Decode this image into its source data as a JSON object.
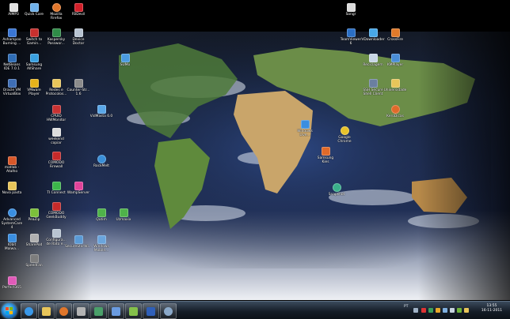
{
  "desktop": {
    "icons": [
      {
        "label": "AIMP3",
        "icon": "aimp-icon",
        "color": "#e2e2e2"
      },
      {
        "label": "Quick Care",
        "icon": "quickcare-icon",
        "color": "#6fb1ea"
      },
      {
        "label": "Mozilla Firefox",
        "icon": "firefox-icon",
        "color": "#e0762b"
      },
      {
        "label": "FBDevil",
        "icon": "fbdevil-icon",
        "color": "#d2202a"
      },
      {
        "label": "Ashampoo Burning ...",
        "icon": "ashampoo-icon",
        "color": "#3a76d4"
      },
      {
        "label": "Switch to Gamin...",
        "icon": "switch-gaming-icon",
        "color": "#c8302e"
      },
      {
        "label": "Kaspersky Passwor...",
        "icon": "kaspersky-icon",
        "color": "#2f8c47"
      },
      {
        "label": "Device Doctor",
        "icon": "device-doctor-icon",
        "color": "#b8c4d2"
      },
      {
        "label": "NetBeans IDE 7.0.1",
        "icon": "netbeans-icon",
        "color": "#2f6db5"
      },
      {
        "label": "Samsung AllShare",
        "icon": "allshare-icon",
        "color": "#3aa0e0"
      },
      {
        "label": "Oracle VM VirtualBox",
        "icon": "virtualbox-icon",
        "color": "#3f6fb6"
      },
      {
        "label": "VMware Player",
        "icon": "vmware-icon",
        "color": "#e6b21a"
      },
      {
        "label": "Redes e Protocolos...",
        "icon": "folder-icon",
        "color": "#e8c55a"
      },
      {
        "label": "Counter-Str... 1.6",
        "icon": "counter-strike-icon",
        "color": "#8c8c8c"
      },
      {
        "label": "SUMo",
        "icon": "sumo-icon",
        "color": "#4a9be0"
      },
      {
        "label": "CPUID HWMonitor",
        "icon": "hwmonitor-icon",
        "color": "#c83232"
      },
      {
        "label": "VidMasta 6.0",
        "icon": "vidmasta-icon",
        "color": "#5aa7e8"
      },
      {
        "label": "weekend copiar",
        "icon": "document-icon",
        "color": "#dcdcdc"
      },
      {
        "label": "COMODO Firewall",
        "icon": "comodo-firewall-icon",
        "color": "#c62a2a"
      },
      {
        "label": "RockMelt",
        "icon": "rockmelt-icon",
        "color": "#3a8fd8"
      },
      {
        "label": "matlab - Atalho",
        "icon": "matlab-icon",
        "color": "#d8582a"
      },
      {
        "label": "Nova pasta",
        "icon": "folder-icon",
        "color": "#e8c55a"
      },
      {
        "label": "TI Connect",
        "icon": "ti-connect-icon",
        "color": "#3cb54a"
      },
      {
        "label": "WampServer",
        "icon": "wampserver-icon",
        "color": "#e0439a"
      },
      {
        "label": "Advanced SystemCare 4",
        "icon": "systemcare-icon",
        "color": "#3a8ee0"
      },
      {
        "label": "PeaZip",
        "icon": "peazip-icon",
        "color": "#7cbf3a"
      },
      {
        "label": "COMODO GeekBuddy",
        "icon": "geekbuddy-icon",
        "color": "#c62a2a"
      },
      {
        "label": "Qutim",
        "icon": "qutim-icon",
        "color": "#4fb24a"
      },
      {
        "label": "Uzmaxix",
        "icon": "uzmaxix-icon",
        "color": "#4fb24a"
      },
      {
        "label": "IObit Malwa...",
        "icon": "iobit-icon",
        "color": "#3a8ee0"
      },
      {
        "label": "SharePod",
        "icon": "sharepod-icon",
        "color": "#b0b0b0"
      },
      {
        "label": "Configura... de Rato e...",
        "icon": "mouse-settings-icon",
        "color": "#b8c4d2"
      },
      {
        "label": "SecureStorWi...",
        "icon": "securestor-icon",
        "color": "#5a9ad6"
      },
      {
        "label": "Windows Mobile...",
        "icon": "windows-mobile-icon",
        "color": "#6aa4dc"
      },
      {
        "label": "SpeedFan",
        "icon": "speedfan-icon",
        "color": "#7d7d7d"
      },
      {
        "label": "Perfect365",
        "icon": "perfect365-icon",
        "color": "#e05ab8"
      },
      {
        "label": "Songr",
        "icon": "songr-icon",
        "color": "#dcdcdc"
      },
      {
        "label": "TeamViewer 6",
        "icon": "teamviewer-icon",
        "color": "#2b6fc4"
      },
      {
        "label": "VDownloader",
        "icon": "vdownloader-icon",
        "color": "#48a8e8"
      },
      {
        "label": "CrossFire",
        "icon": "crossfire-icon",
        "color": "#e07a2a"
      },
      {
        "label": "Reciclagem",
        "icon": "recycle-bin-icon",
        "color": "#c8d6e6"
      },
      {
        "label": "KMPlayer",
        "icon": "kmplayer-icon",
        "color": "#4a8ed8"
      },
      {
        "label": "SSH Secure Shell Client",
        "icon": "ssh-icon",
        "color": "#6b7fa0"
      },
      {
        "label": "Universidade",
        "icon": "folder-icon",
        "color": "#e8c55a"
      },
      {
        "label": "KeroDicas",
        "icon": "kerodicas-icon",
        "color": "#e06a2a"
      },
      {
        "label": "Windows Live...",
        "icon": "windows-live-icon",
        "color": "#3a8ee0"
      },
      {
        "label": "Google Chrome",
        "icon": "chrome-icon",
        "color": "#e8c22a"
      },
      {
        "label": "Samsung Kies",
        "icon": "kies-icon",
        "color": "#e06a2a"
      },
      {
        "label": "Snapshot",
        "icon": "snapshot-icon",
        "color": "#3ab08a"
      }
    ]
  },
  "taskbar": {
    "items": [
      {
        "name": "taskbar-ie-button",
        "icon": "internet-explorer-icon",
        "color": "#3a98e8"
      },
      {
        "name": "taskbar-explorer-button",
        "icon": "folder-icon",
        "color": "#e8c55a"
      },
      {
        "name": "taskbar-firefox-button",
        "icon": "firefox-icon",
        "color": "#e0762b"
      },
      {
        "name": "taskbar-tool-button",
        "icon": "tool-icon",
        "color": "#b3b3b3"
      },
      {
        "name": "taskbar-network-button",
        "icon": "network-icon",
        "color": "#4aa06a"
      },
      {
        "name": "taskbar-virtualbox-button",
        "icon": "virtualbox-icon",
        "color": "#6a9be0"
      },
      {
        "name": "taskbar-app-button",
        "icon": "app-icon",
        "color": "#84c04a"
      },
      {
        "name": "taskbar-word-button",
        "icon": "word-icon",
        "color": "#2f5fb8"
      },
      {
        "name": "taskbar-media-button",
        "icon": "media-icon",
        "color": "#8aa8c8"
      }
    ],
    "language": "PT",
    "clock_time": "13:55",
    "clock_date": "16-11-2011"
  }
}
